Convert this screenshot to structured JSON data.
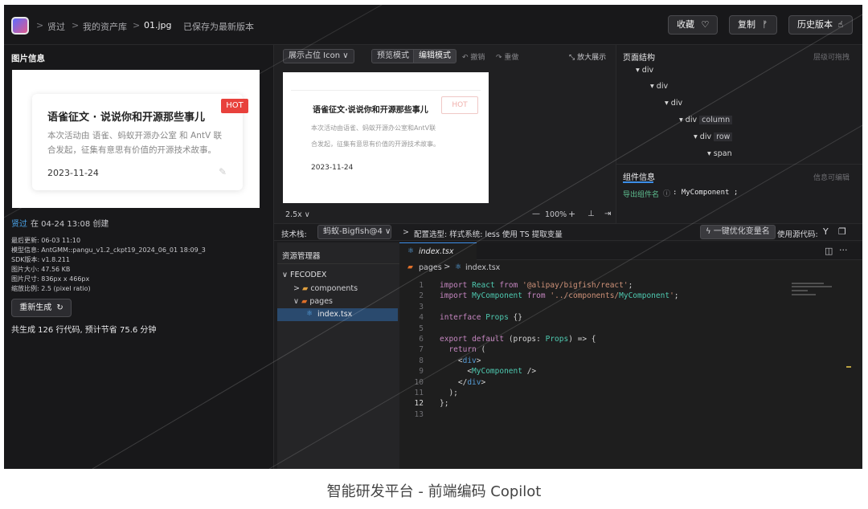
{
  "breadcrumb": {
    "user": "贤过",
    "library": "我的资产库",
    "file": "01.jpg",
    "status": "已保存为最新版本"
  },
  "top_buttons": {
    "favorite": "收藏",
    "copy": "复制",
    "history": "历史版本"
  },
  "left_panel": {
    "title": "图片信息",
    "card_title": "语雀征文 · 说说你和开源那些事儿",
    "card_badge": "HOT",
    "card_body_1": "本次活动由 语雀、蚂蚁开源办公室 和 AntV 联",
    "card_body_2": "合发起，征集有意思有价值的开源技术故事。",
    "card_date": "2023-11-24",
    "creator": "贤过",
    "created": "在 04-24 13:08 创建",
    "meta": [
      "最后更新: 06-03 11:10",
      "模型信息: AntGMM::pangu_v1.2_ckpt19_2024_06_01 18:09_3",
      "SDK版本: v1.8.211",
      "图片大小: 47.56 KB",
      "图片尺寸: 836px x 466px",
      "缩放比例: 2.5 (pixel ratio)"
    ],
    "regen_button": "重新生成",
    "summary": "共生成 126 行代码, 预计节省 75.6 分钟"
  },
  "preview": {
    "placeholder_select": "展示占位 Icon",
    "mode_preview": "预览模式",
    "mode_edit": "编辑模式",
    "undo": "撤销",
    "redo": "重做",
    "expand": "放大展示",
    "card_title": "语雀征文·说说你和开源那些事儿",
    "card_badge": "HOT",
    "card_body_1": "本次活动由语雀、蚂蚁开源办公室和AntV联",
    "card_body_2": "合发起，征集有意思有价值的开源技术故事。",
    "card_date": "2023-11-24",
    "scale": "2.5x",
    "zoom": "100%"
  },
  "structure": {
    "title": "页面结构",
    "hint": "层级可拖拽",
    "nodes": [
      {
        "tag": "div",
        "cls": ""
      },
      {
        "tag": "div",
        "cls": ""
      },
      {
        "tag": "div",
        "cls": ""
      },
      {
        "tag": "div",
        "cls": "column"
      },
      {
        "tag": "div",
        "cls": "row"
      },
      {
        "tag": "span",
        "cls": ""
      }
    ],
    "component_tab": "组件信息",
    "component_hint": "信息可编辑",
    "export_label": "导出组件名",
    "export_value": ": MyComponent ;"
  },
  "toolbar": {
    "stack_label": "技术栈:",
    "stack_value": "蚂蚁-Bigfish@4",
    "config": "配置选型: 样式系统: less 使用 TS 提取变量",
    "optimize": "一键优化变量名",
    "source_label": "使用源代码:"
  },
  "explorer": {
    "title": "资源管理器",
    "root": "FECODEX",
    "items": [
      "components",
      "pages",
      "index.tsx"
    ]
  },
  "editor": {
    "tab": "index.tsx",
    "path_folder": "pages",
    "path_file": "index.tsx",
    "lines": [
      "import React from '@alipay/bigfish/react';",
      "import MyComponent from '../components/MyComponent';",
      "",
      "interface Props {}",
      "",
      "export default (props: Props) => {",
      "  return (",
      "    <div>",
      "      <MyComponent />",
      "    </div>",
      "  );",
      "};",
      ""
    ]
  },
  "caption": "智能研发平台 - 前端编码 Copilot"
}
